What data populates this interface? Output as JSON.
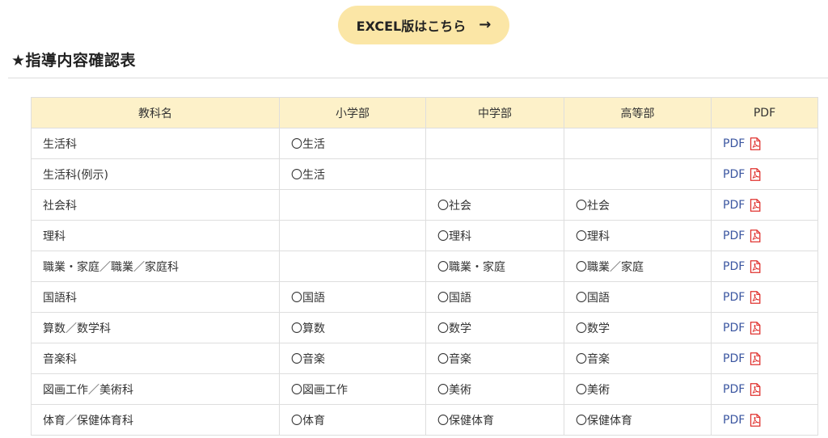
{
  "excel_button": {
    "label": "EXCEL版はこちら",
    "arrow": "→"
  },
  "section": {
    "title": "★指導内容確認表"
  },
  "table": {
    "headers": [
      "教科名",
      "小学部",
      "中学部",
      "高等部",
      "PDF"
    ],
    "rows": [
      {
        "subject": "生活科",
        "elementary": "〇生活",
        "junior": "",
        "senior": "",
        "pdf": "PDF"
      },
      {
        "subject": "生活科(例示)",
        "elementary": "〇生活",
        "junior": "",
        "senior": "",
        "pdf": "PDF"
      },
      {
        "subject": "社会科",
        "elementary": "",
        "junior": "〇社会",
        "senior": "〇社会",
        "pdf": "PDF"
      },
      {
        "subject": "理科",
        "elementary": "",
        "junior": "〇理科",
        "senior": "〇理科",
        "pdf": "PDF"
      },
      {
        "subject": "職業・家庭／職業／家庭科",
        "elementary": "",
        "junior": "〇職業・家庭",
        "senior": "〇職業／家庭",
        "pdf": "PDF"
      },
      {
        "subject": "国語科",
        "elementary": "〇国語",
        "junior": "〇国語",
        "senior": "〇国語",
        "pdf": "PDF"
      },
      {
        "subject": "算数／数学科",
        "elementary": "〇算数",
        "junior": "〇数学",
        "senior": "〇数学",
        "pdf": "PDF"
      },
      {
        "subject": "音楽科",
        "elementary": "〇音楽",
        "junior": "〇音楽",
        "senior": "〇音楽",
        "pdf": "PDF"
      },
      {
        "subject": "図画工作／美術科",
        "elementary": "〇図画工作",
        "junior": "〇美術",
        "senior": "〇美術",
        "pdf": "PDF"
      },
      {
        "subject": "体育／保健体育科",
        "elementary": "〇体育",
        "junior": "〇保健体育",
        "senior": "〇保健体育",
        "pdf": "PDF"
      }
    ]
  },
  "colors": {
    "button_bg": "#fbe6a6",
    "header_bg": "#fdf1c9",
    "link": "#3a55a0",
    "pdf_icon": "#e0322f"
  },
  "icons": {
    "arrow": "arrow-right-icon",
    "pdf": "pdf-file-icon"
  }
}
